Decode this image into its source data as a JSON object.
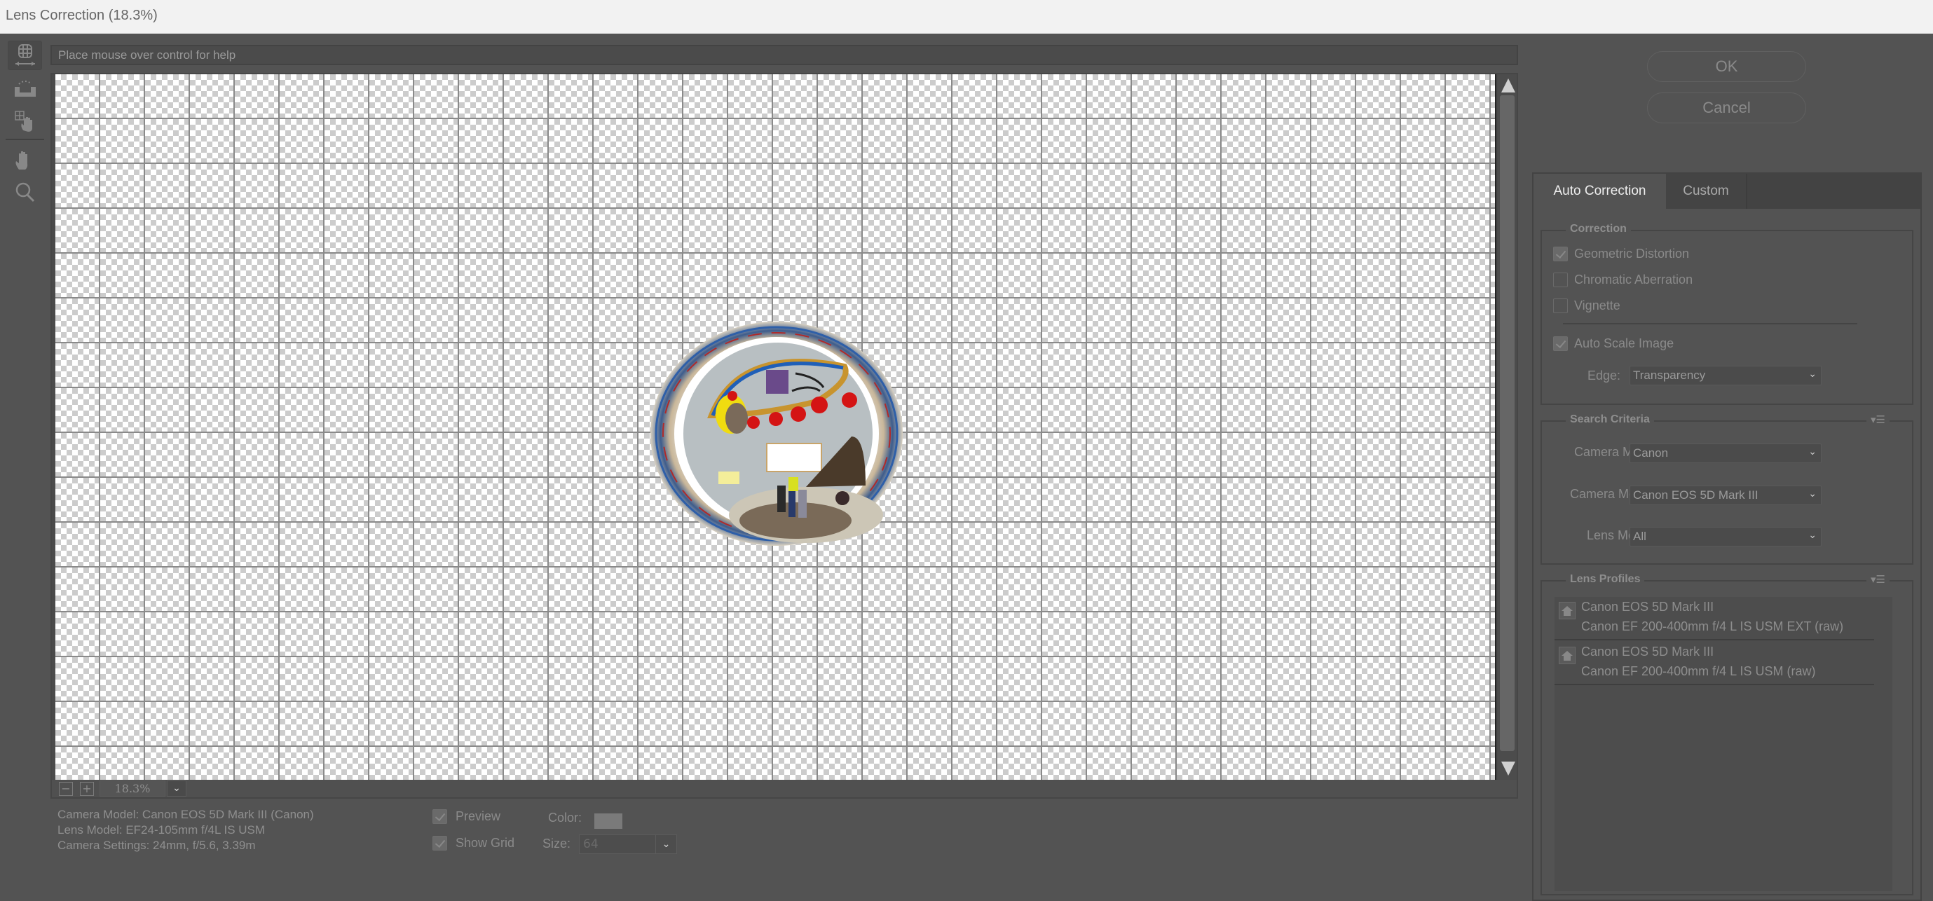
{
  "window": {
    "title": "Lens Correction (18.3%)"
  },
  "toolbar": {
    "tools": [
      {
        "name": "remove-distortion-tool",
        "active": true
      },
      {
        "name": "straighten-tool",
        "active": false
      },
      {
        "name": "move-grid-tool",
        "active": false
      },
      {
        "name": "hand-tool",
        "active": false
      },
      {
        "name": "zoom-tool",
        "active": false
      }
    ]
  },
  "help": {
    "text": "Place mouse over control for help"
  },
  "canvas": {
    "zoom_value": "18.3%",
    "zoom_out_label": "−",
    "zoom_in_label": "+",
    "dropdown_glyph": "⌄"
  },
  "info": {
    "camera_model": "Camera Model: Canon EOS 5D Mark III (Canon)",
    "lens_model": "Lens Model: EF24-105mm f/4L IS USM",
    "camera_settings": "Camera Settings: 24mm, f/5.6, 3.39m"
  },
  "view_options": {
    "preview_label": "Preview",
    "preview_checked": true,
    "show_grid_label": "Show Grid",
    "show_grid_checked": true,
    "color_label": "Color:",
    "grid_color": "#7a7a7a",
    "size_label": "Size:",
    "size_value": "64"
  },
  "buttons": {
    "ok": "OK",
    "cancel": "Cancel"
  },
  "tabs": [
    {
      "label": "Auto Correction",
      "active": true
    },
    {
      "label": "Custom",
      "active": false
    }
  ],
  "correction": {
    "title": "Correction",
    "geometric_distortion": {
      "label": "Geometric Distortion",
      "checked": true
    },
    "chromatic_aberration": {
      "label": "Chromatic Aberration",
      "checked": false
    },
    "vignette": {
      "label": "Vignette",
      "checked": false
    },
    "auto_scale": {
      "label": "Auto Scale Image",
      "checked": true
    },
    "edge_label": "Edge:",
    "edge_value": "Transparency"
  },
  "search_criteria": {
    "title": "Search Criteria",
    "menu_glyph": "▾☰",
    "camera_make_label": "Camera Make:",
    "camera_make_value": "Canon",
    "camera_model_label": "Camera Model:",
    "camera_model_value": "Canon EOS 5D Mark III",
    "lens_model_label": "Lens Model:",
    "lens_model_value": "All"
  },
  "lens_profiles": {
    "title": "Lens Profiles",
    "menu_glyph": "▾☰",
    "items": [
      {
        "camera": "Canon EOS 5D Mark III",
        "lens": "Canon EF 200-400mm f/4 L IS USM EXT (raw)"
      },
      {
        "camera": "Canon EOS 5D Mark III",
        "lens": "Canon EF 200-400mm f/4 L IS USM (raw)"
      }
    ]
  }
}
